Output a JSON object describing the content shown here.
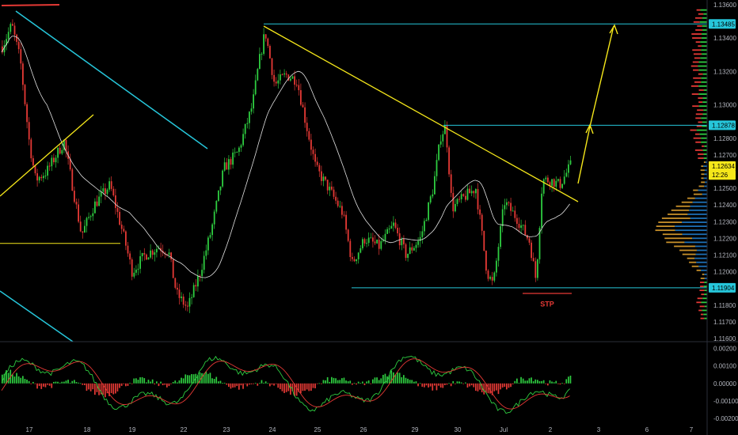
{
  "chart_data": [
    {
      "type": "candlestick",
      "title": "",
      "y_axis_ticks": [
        "1.13600",
        "1.13400",
        "1.13200",
        "1.13000",
        "1.12800",
        "1.12700",
        "1.12500",
        "1.12400",
        "1.12300",
        "1.12200",
        "1.12100",
        "1.12000",
        "1.11800",
        "1.11700",
        "1.11600"
      ],
      "x_axis_ticks": [
        "17",
        "18",
        "19",
        "22",
        "23",
        "24",
        "25",
        "26",
        "29",
        "30",
        "Jul",
        "2",
        "3",
        "6",
        "7"
      ],
      "ylim": [
        1.116,
        1.136
      ],
      "price_badges": [
        {
          "label": "1.13485",
          "value": 1.13485,
          "color": "#26c6da"
        },
        {
          "label": "1.12878",
          "value": 1.12878,
          "color": "#26c6da"
        },
        {
          "label": "1.12634",
          "value": 1.12634,
          "color": "#f5e71a"
        },
        {
          "label": "12:26",
          "value": 1.1258,
          "color": "#f5e71a"
        },
        {
          "label": "1.11904",
          "value": 1.11904,
          "color": "#26c6da"
        }
      ],
      "horizontal_levels": [
        {
          "value": 1.13485,
          "color": "#26c6da"
        },
        {
          "value": 1.12878,
          "color": "#26c6da"
        },
        {
          "value": 1.11904,
          "color": "#26c6da"
        },
        {
          "value": 1.1217,
          "color": "#f5e71a"
        }
      ],
      "annotation": {
        "text": "STP",
        "value": 1.1182,
        "color": "#e53935"
      },
      "moving_average": {
        "color": "#e0e0e0"
      },
      "colors": {
        "up": "#2ecc40",
        "down": "#e53935",
        "volume_profile_up": "#1e6fb5",
        "volume_profile_down": "#c8902a"
      }
    },
    {
      "type": "histogram",
      "title": "",
      "y_axis_ticks": [
        "0.00200",
        "0.00100",
        "0.00000",
        "-0.00100",
        "-0.00200"
      ],
      "ylim": [
        -0.0024,
        0.0022
      ],
      "lines": [
        {
          "color": "#2ecc40"
        },
        {
          "color": "#e53935"
        }
      ]
    }
  ]
}
